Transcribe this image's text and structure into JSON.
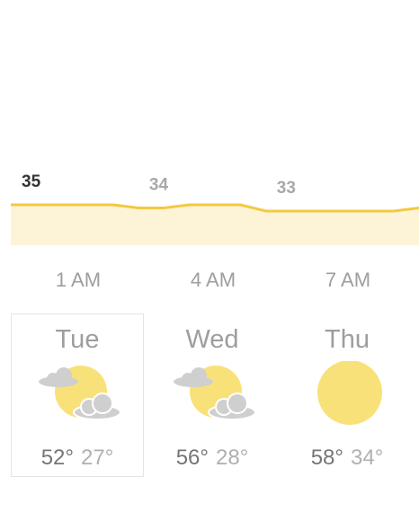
{
  "colors": {
    "line": "#f4c842",
    "fill": "#fdf4d8",
    "sun": "#f9e17a",
    "cloud": "#cfcfcf",
    "label_active": "#333333",
    "label": "#9e9e9e"
  },
  "chart_data": {
    "type": "area",
    "series": [
      {
        "values": [
          35,
          35,
          35,
          35,
          35,
          34,
          34,
          35,
          35,
          35,
          33,
          33,
          33,
          33,
          33,
          33,
          34
        ]
      }
    ],
    "data_labels": [
      {
        "text": "35",
        "value": 35,
        "point": 0,
        "active": true
      },
      {
        "text": "34",
        "value": 34,
        "point": 5,
        "active": false
      },
      {
        "text": "33",
        "value": 33,
        "point": 10,
        "active": false
      }
    ],
    "xlabels": [
      "1 AM",
      "4 AM",
      "7 AM"
    ],
    "grid": false,
    "legend": false
  },
  "forecast": [
    {
      "day": "Tue",
      "icon": "partly-cloudy-icon",
      "high": "52°",
      "low": "27°",
      "selected": true
    },
    {
      "day": "Wed",
      "icon": "partly-cloudy-icon",
      "high": "56°",
      "low": "28°",
      "selected": false
    },
    {
      "day": "Thu",
      "icon": "sunny-icon",
      "high": "58°",
      "low": "34°",
      "selected": false
    }
  ]
}
